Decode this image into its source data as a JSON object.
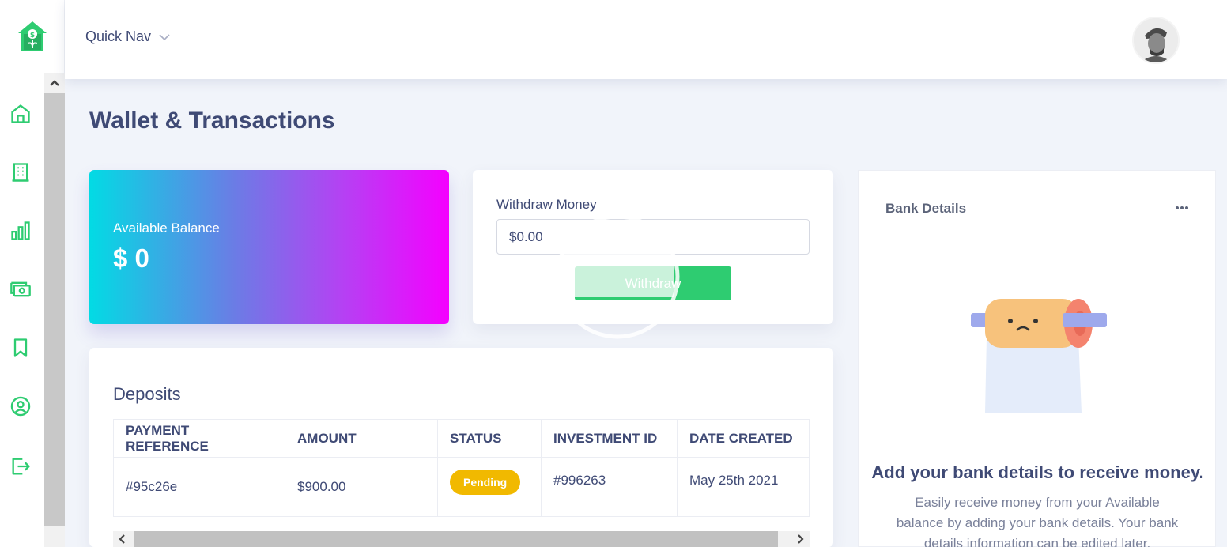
{
  "header": {
    "quick_nav_label": "Quick Nav"
  },
  "sidebar": {
    "items": [
      {
        "icon": "home-icon"
      },
      {
        "icon": "building-icon"
      },
      {
        "icon": "bar-chart-icon"
      },
      {
        "icon": "cash-icon"
      },
      {
        "icon": "bookmark-icon"
      },
      {
        "icon": "user-circle-icon"
      },
      {
        "icon": "logout-icon"
      }
    ]
  },
  "page": {
    "title": "Wallet & Transactions"
  },
  "balance": {
    "label": "Available Balance",
    "value": "$ 0"
  },
  "withdraw": {
    "label": "Withdraw Money",
    "input_value": "$0.00",
    "button_label": "Withdraw"
  },
  "deposits": {
    "title": "Deposits",
    "columns": [
      "PAYMENT REFERENCE",
      "AMOUNT",
      "STATUS",
      "INVESTMENT ID",
      "DATE CREATED"
    ],
    "rows": [
      {
        "reference": "#95c26e",
        "amount": "$900.00",
        "status": "Pending",
        "investment_id": "#996263",
        "date": "May 25th 2021"
      }
    ]
  },
  "bank": {
    "title": "Bank Details",
    "headline": "Add your bank details to receive money.",
    "description": "Easily receive money from your Available balance by adding your bank details. Your bank details information can be edited later."
  },
  "colors": {
    "brand_green": "#2ecc71",
    "text_primary": "#3f4a75",
    "pending_badge": "#f1b900"
  }
}
